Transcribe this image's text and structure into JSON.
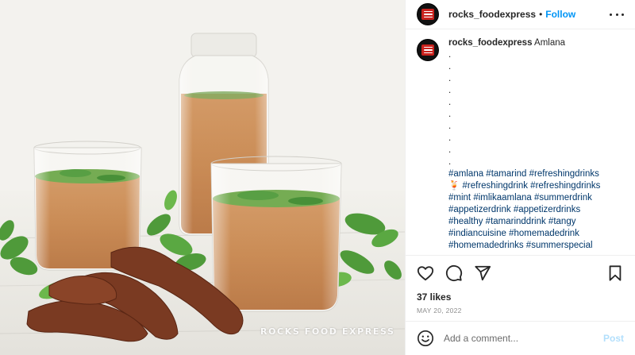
{
  "account": {
    "username": "rocks_foodexpress",
    "follow_label": "Follow",
    "separator": "•",
    "avatar_badge_text": "ROCKS FOOD EXPRESS"
  },
  "caption": {
    "username": "rocks_foodexpress",
    "title": "Amlana",
    "dots": [
      ".",
      ".",
      ".",
      ".",
      ".",
      ".",
      ".",
      ".",
      ".",
      "."
    ],
    "hashtag_lines": [
      "#amlana #tamarind #refreshingdrinks",
      "🍹 #refreshingdrink #refreshingdrinks",
      "#mint #imlikaamlana #summerdrink",
      "#appetizerdrink #appetizerdrinks",
      "#healthy #tamarinddrink #tangy",
      "#indiancuisine #homemadedrink",
      "#homemadedrinks #summerspecial"
    ]
  },
  "stats": {
    "likes": "37 likes",
    "date": "MAY 20, 2022"
  },
  "comment_box": {
    "placeholder": "Add a comment...",
    "post_label": "Post"
  },
  "media": {
    "watermark": "ROCKS FOOD EXPRESS"
  },
  "icons": {
    "like": "heart-icon",
    "comment": "comment-bubble-icon",
    "share": "paper-plane-icon",
    "save": "bookmark-icon",
    "emoji": "smiley-icon",
    "more": "more-options-icon"
  },
  "colors": {
    "link_blue": "#0095f6",
    "hashtag": "#00376b",
    "post_disabled": "#b2dffc",
    "drink": "#c98b52"
  }
}
